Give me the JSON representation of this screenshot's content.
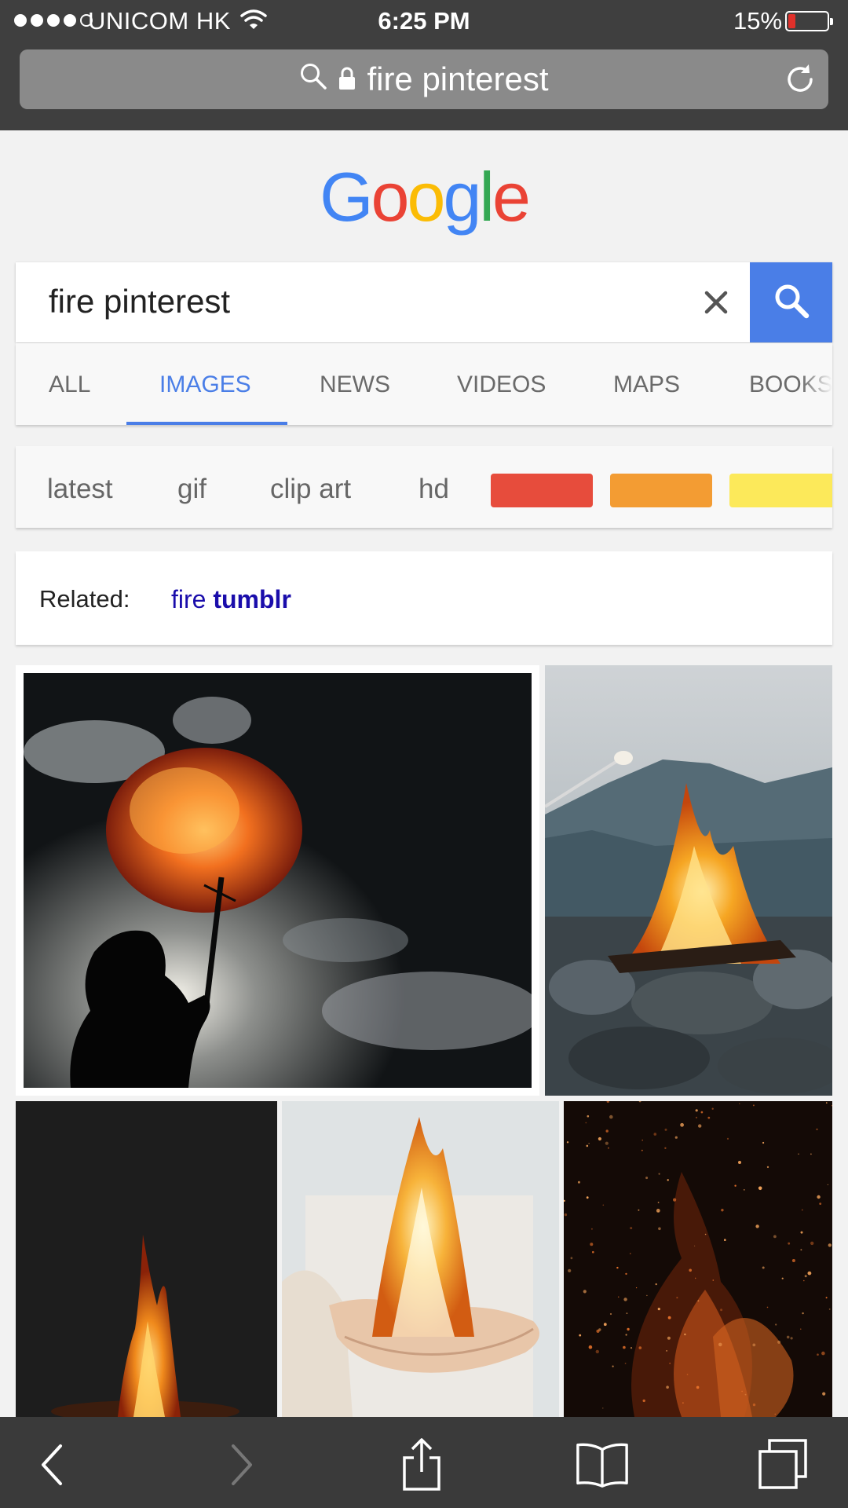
{
  "status_bar": {
    "carrier": "UNICOM HK",
    "time": "6:25 PM",
    "battery": "15%",
    "battery_level": 0.15,
    "signal_bars_filled": 4,
    "signal_bars_total": 5
  },
  "address_bar": {
    "url_text": "fire pinterest"
  },
  "logo": {
    "letters": [
      "G",
      "o",
      "o",
      "g",
      "l",
      "e"
    ],
    "colors": [
      "#4285f4",
      "#ea4335",
      "#fbbc05",
      "#4285f4",
      "#34a853",
      "#ea4335"
    ]
  },
  "search": {
    "query": "fire pinterest",
    "accent": "#4a7ee7"
  },
  "tabs": [
    {
      "label": "ALL",
      "active": false
    },
    {
      "label": "IMAGES",
      "active": true
    },
    {
      "label": "NEWS",
      "active": false
    },
    {
      "label": "VIDEOS",
      "active": false
    },
    {
      "label": "MAPS",
      "active": false
    },
    {
      "label": "BOOKS",
      "active": false
    }
  ],
  "chips": {
    "text": [
      "latest",
      "gif",
      "clip art",
      "hd"
    ],
    "color_swatches": [
      "#e74c3c",
      "#f39c33",
      "#fce95a"
    ]
  },
  "related": {
    "label": "Related:",
    "link_prefix": "fire",
    "link_bold": "tumblr"
  },
  "results": [
    {
      "subject": "fire breather silhouette"
    },
    {
      "subject": "campfire with marshmallow"
    },
    {
      "subject": "small bonfire at night"
    },
    {
      "subject": "flame in cupped hands"
    },
    {
      "subject": "sparks and embers"
    }
  ],
  "toolbar": {
    "icons": [
      "back-icon",
      "forward-icon",
      "share-icon",
      "bookmarks-icon",
      "tabs-icon"
    ]
  }
}
